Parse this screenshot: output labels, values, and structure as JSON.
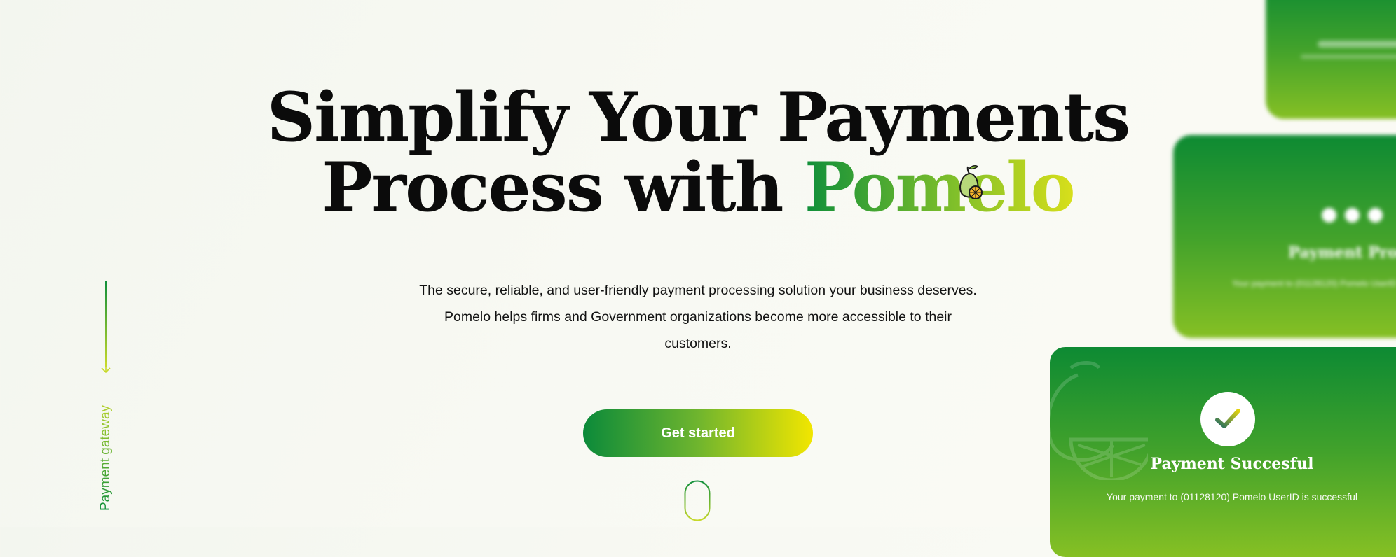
{
  "hero": {
    "title_line1": "Simplify Your Payments",
    "title_line2_prefix": "Process with ",
    "title_brand": "Pomelo",
    "description": "The secure, reliable, and user-friendly payment processing solution your business deserves. Pomelo helps firms and Government organizations become more accessible to their customers.",
    "cta_label": "Get started"
  },
  "side": {
    "label": "Payment gateway"
  },
  "cards": {
    "mid_title": "Payment Processing",
    "mid_sub": "Your payment to (01128120) Pomelo UserID",
    "front_title": "Payment Succesful",
    "front_sub": "Your payment to (01128120) Pomelo UserID is successful"
  },
  "colors": {
    "brand_green": "#0f8f3a",
    "brand_lime": "#c7d92a",
    "cta_yellow": "#f2e600"
  },
  "icons": [
    "pomelo-fruit-icon",
    "scroll-mouse-icon",
    "arrow-down-icon",
    "checkmark-icon",
    "pomelo-watermark-icon"
  ]
}
